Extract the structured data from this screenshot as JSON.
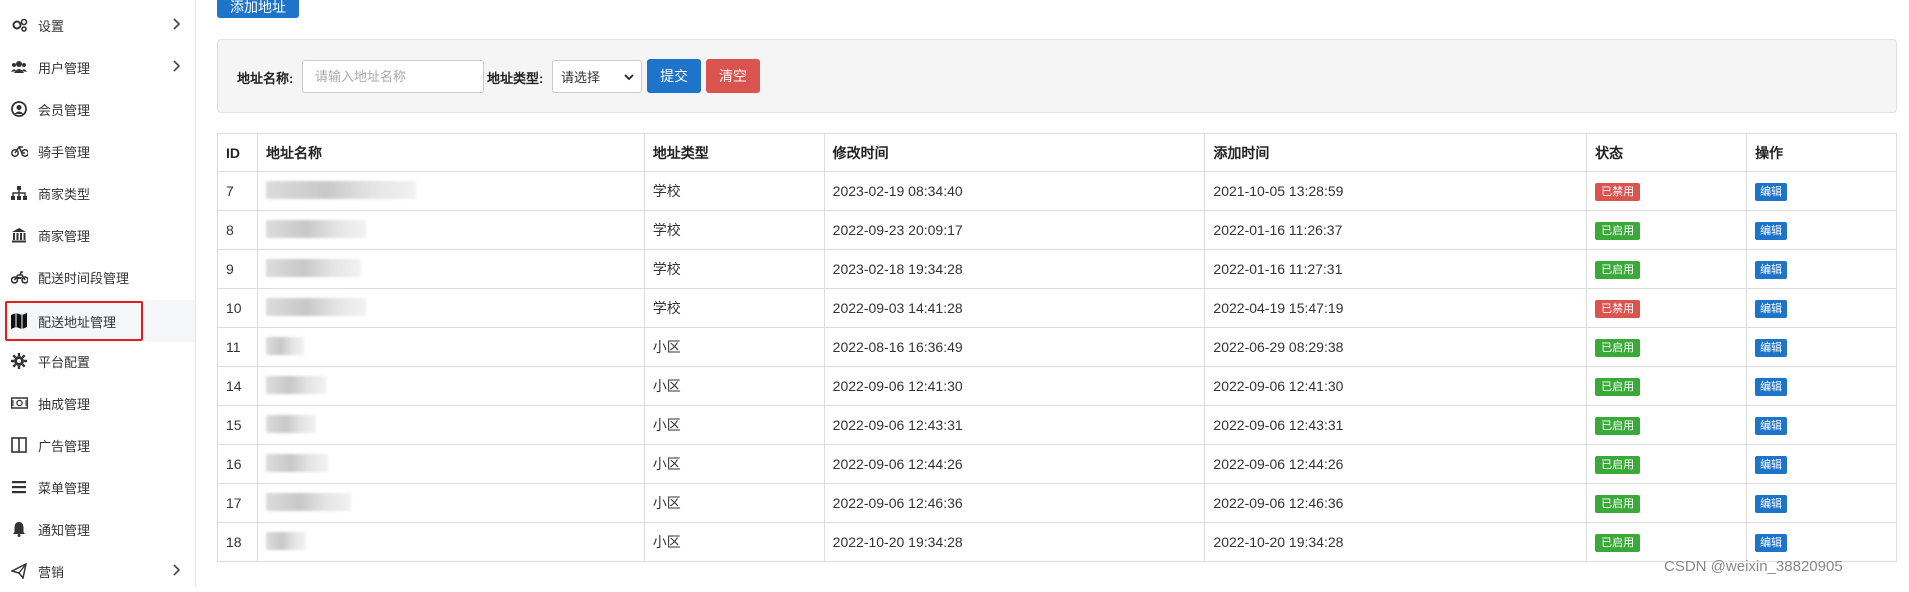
{
  "sidebar": {
    "items": [
      {
        "label": "设置",
        "icon": "gears-icon",
        "chevron": true
      },
      {
        "label": "用户管理",
        "icon": "users-icon",
        "chevron": true
      },
      {
        "label": "会员管理",
        "icon": "user-circle-icon",
        "chevron": false
      },
      {
        "label": "骑手管理",
        "icon": "bicycle-icon",
        "chevron": false
      },
      {
        "label": "商家类型",
        "icon": "sitemap-icon",
        "chevron": false
      },
      {
        "label": "商家管理",
        "icon": "bank-icon",
        "chevron": false
      },
      {
        "label": "配送时间段管理",
        "icon": "motorcycle-icon",
        "chevron": false
      },
      {
        "label": "配送地址管理",
        "icon": "map-icon",
        "chevron": false,
        "active": true
      },
      {
        "label": "平台配置",
        "icon": "gear-icon",
        "chevron": false
      },
      {
        "label": "抽成管理",
        "icon": "money-icon",
        "chevron": false
      },
      {
        "label": "广告管理",
        "icon": "columns-icon",
        "chevron": false
      },
      {
        "label": "菜单管理",
        "icon": "bars-icon",
        "chevron": false
      },
      {
        "label": "通知管理",
        "icon": "bell-icon",
        "chevron": false
      },
      {
        "label": "营销",
        "icon": "paper-plane-icon",
        "chevron": true
      }
    ]
  },
  "toolbar": {
    "add_label": "添加地址"
  },
  "filter": {
    "name_label": "地址名称:",
    "name_placeholder": "请输入地址名称",
    "name_value": "",
    "type_label": "地址类型:",
    "type_selected": "请选择",
    "submit_label": "提交",
    "clear_label": "清空"
  },
  "table": {
    "headers": [
      "ID",
      "地址名称",
      "地址类型",
      "修改时间",
      "添加时间",
      "状态",
      "操作"
    ],
    "rows": [
      {
        "id": "7",
        "type": "学校",
        "modified": "2023-02-19 08:34:40",
        "added": "2021-10-05 13:28:59",
        "status": "已禁用",
        "enabled": false,
        "action": "编辑"
      },
      {
        "id": "8",
        "type": "学校",
        "modified": "2022-09-23 20:09:17",
        "added": "2022-01-16 11:26:37",
        "status": "已启用",
        "enabled": true,
        "action": "编辑"
      },
      {
        "id": "9",
        "type": "学校",
        "modified": "2023-02-18 19:34:28",
        "added": "2022-01-16 11:27:31",
        "status": "已启用",
        "enabled": true,
        "action": "编辑"
      },
      {
        "id": "10",
        "type": "学校",
        "modified": "2022-09-03 14:41:28",
        "added": "2022-04-19 15:47:19",
        "status": "已禁用",
        "enabled": false,
        "action": "编辑"
      },
      {
        "id": "11",
        "type": "小区",
        "modified": "2022-08-16 16:36:49",
        "added": "2022-06-29 08:29:38",
        "status": "已启用",
        "enabled": true,
        "action": "编辑"
      },
      {
        "id": "14",
        "type": "小区",
        "modified": "2022-09-06 12:41:30",
        "added": "2022-09-06 12:41:30",
        "status": "已启用",
        "enabled": true,
        "action": "编辑"
      },
      {
        "id": "15",
        "type": "小区",
        "modified": "2022-09-06 12:43:31",
        "added": "2022-09-06 12:43:31",
        "status": "已启用",
        "enabled": true,
        "action": "编辑"
      },
      {
        "id": "16",
        "type": "小区",
        "modified": "2022-09-06 12:44:26",
        "added": "2022-09-06 12:44:26",
        "status": "已启用",
        "enabled": true,
        "action": "编辑"
      },
      {
        "id": "17",
        "type": "小区",
        "modified": "2022-09-06 12:46:36",
        "added": "2022-09-06 12:46:36",
        "status": "已启用",
        "enabled": true,
        "action": "编辑"
      },
      {
        "id": "18",
        "type": "小区",
        "modified": "2022-10-20 19:34:28",
        "added": "2022-10-20 19:34:28",
        "status": "已启用",
        "enabled": true,
        "action": "编辑"
      }
    ]
  },
  "watermark": "CSDN @weixin_38820905",
  "colors": {
    "primary": "#1e74c9",
    "danger": "#d9534f",
    "success": "#3aa93a",
    "highlight": "#e02020"
  }
}
